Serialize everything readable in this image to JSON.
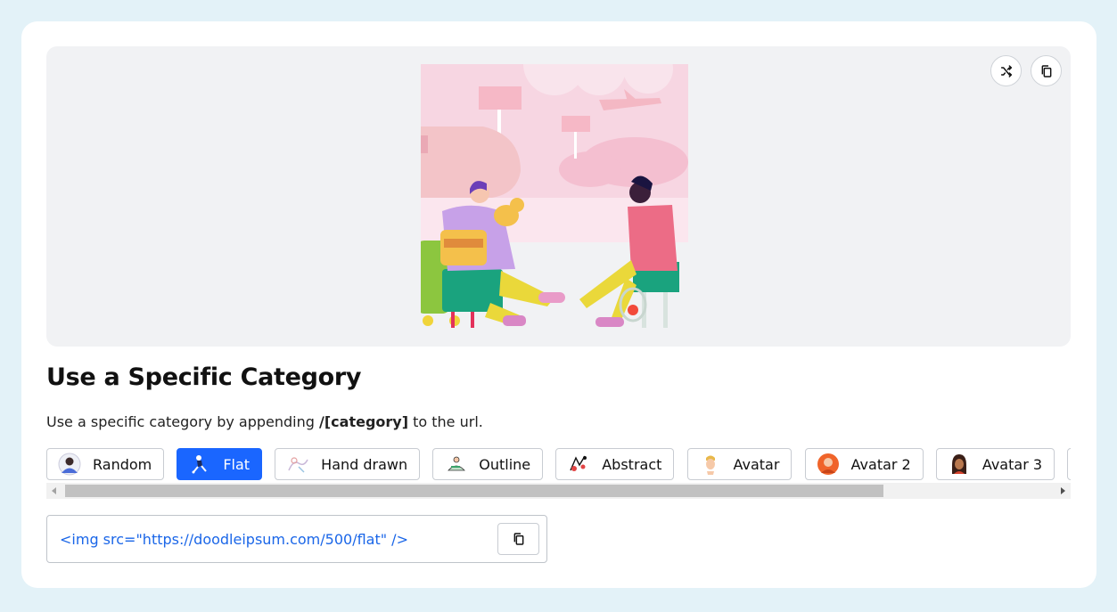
{
  "section": {
    "title": "Use a Specific Category",
    "description_prefix": "Use a specific category by appending ",
    "description_code": "/[category]",
    "description_suffix": " to the url."
  },
  "preview": {
    "shuffle_icon": "shuffle-icon",
    "copy_icon": "copy-icon",
    "illustration": "flat-illustration"
  },
  "categories": [
    {
      "label": "Random",
      "active": false,
      "icon": "random-avatar-thumb"
    },
    {
      "label": "Flat",
      "active": true,
      "icon": "flat-figure-thumb"
    },
    {
      "label": "Hand drawn",
      "active": false,
      "icon": "hand-drawn-thumb"
    },
    {
      "label": "Outline",
      "active": false,
      "icon": "outline-thumb"
    },
    {
      "label": "Abstract",
      "active": false,
      "icon": "abstract-thumb"
    },
    {
      "label": "Avatar",
      "active": false,
      "icon": "avatar-thumb"
    },
    {
      "label": "Avatar 2",
      "active": false,
      "icon": "avatar-2-thumb"
    },
    {
      "label": "Avatar 3",
      "active": false,
      "icon": "avatar-3-thumb"
    },
    {
      "label": "",
      "active": false,
      "icon": "avatar-4-thumb"
    }
  ],
  "code": {
    "snippet": "<img src=\"https://doodleipsum.com/500/flat\" />",
    "copy_icon": "copy-icon"
  },
  "colors": {
    "accent": "#1a66ff",
    "background": "#e3f2f8",
    "code_text": "#1a66e8"
  }
}
